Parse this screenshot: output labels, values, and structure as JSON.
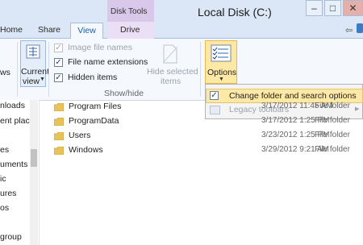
{
  "window": {
    "title": "Local Disk (C:)",
    "context_group": "Disk Tools",
    "controls": {
      "minimize": "–",
      "maximize": "□",
      "close": "✕"
    }
  },
  "tabs": [
    {
      "label": "Home"
    },
    {
      "label": "Share"
    },
    {
      "label": "View"
    },
    {
      "label": "Drive"
    }
  ],
  "ribbon": {
    "panes_partial": "ws",
    "current_view": {
      "line1": "Current",
      "line2": "view"
    },
    "show_hide": {
      "image_file_names": "Image file names",
      "file_name_extensions": "File name extensions",
      "hidden_items": "Hidden items",
      "hide_selected": {
        "line1": "Hide selected",
        "line2": "items"
      },
      "group_label": "Show/hide"
    },
    "options": {
      "label": "Options"
    }
  },
  "options_menu": {
    "item1": "Change folder and search options",
    "item2": "Legacy toolbars"
  },
  "nav_pane": {
    "items": [
      "nloads",
      "ent plac",
      "es",
      "uments",
      "ic",
      "ures",
      "os",
      "group"
    ]
  },
  "files": [
    {
      "name": "Program Files",
      "date": "3/17/2012 11:45 AM",
      "type": "File folder"
    },
    {
      "name": "ProgramData",
      "date": "3/17/2012 1:25 PM",
      "type": "File folder"
    },
    {
      "name": "Users",
      "date": "3/23/2012 1:25 PM",
      "type": "File folder"
    },
    {
      "name": "Windows",
      "date": "3/29/2012 9:21 AM",
      "type": "File folder"
    }
  ],
  "colors": {
    "titlebar": "#dbe7f6",
    "context_tab": "#d9c8ea",
    "options_highlight": "#fde9a5",
    "folder": "#e8c35a"
  }
}
